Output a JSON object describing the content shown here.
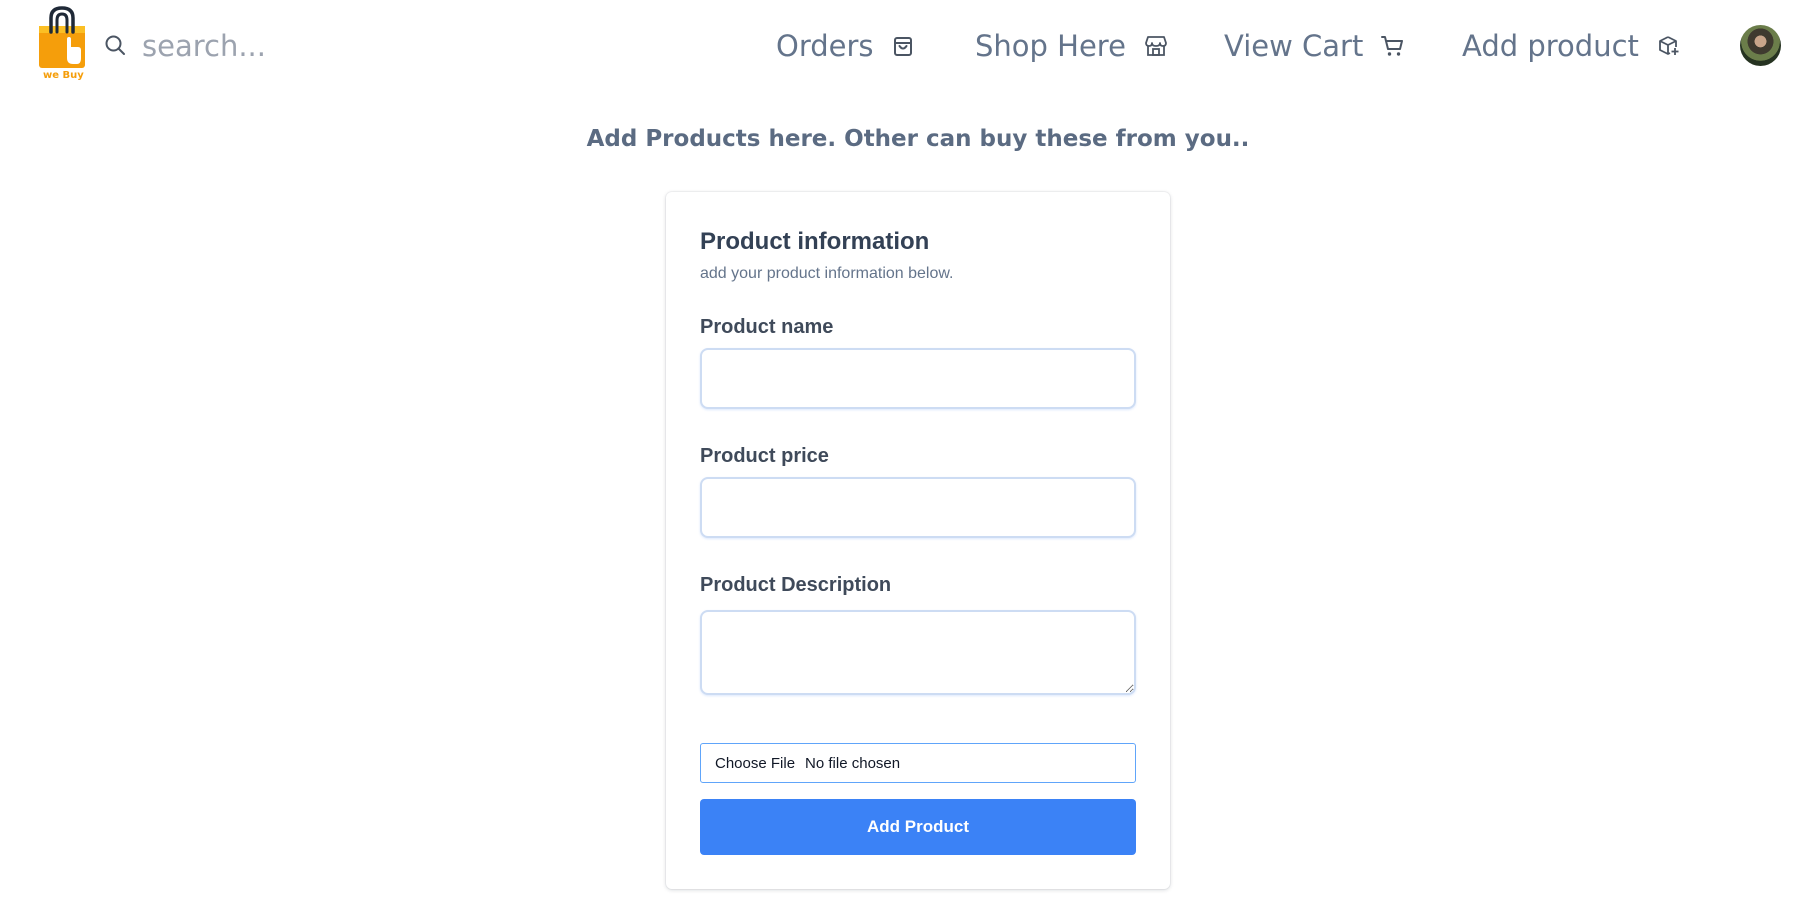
{
  "brand": {
    "logo_text": "we Buy",
    "accent": "#f59e0b",
    "icon": "shopping-bag-hand-icon"
  },
  "search": {
    "placeholder": "search...",
    "value": "",
    "icon": "search-icon"
  },
  "nav": {
    "orders": {
      "label": "Orders",
      "icon": "bag-icon"
    },
    "shop": {
      "label": "Shop Here",
      "icon": "storefront-icon"
    },
    "cart": {
      "label": "View Cart",
      "icon": "cart-icon"
    },
    "add_product": {
      "label": "Add product",
      "icon": "box-plus-icon"
    }
  },
  "user": {
    "avatar": "user-avatar-photo"
  },
  "page": {
    "heading": "Add Products here. Other can buy these from you.."
  },
  "form": {
    "title": "Product information",
    "subtitle": "add your product information below.",
    "fields": {
      "name": {
        "label": "Product name",
        "value": ""
      },
      "price": {
        "label": "Product price",
        "value": ""
      },
      "description": {
        "label": "Product Description",
        "value": ""
      }
    },
    "file": {
      "button_label": "Choose File",
      "status": "No file chosen"
    },
    "submit_label": "Add Product",
    "primary_color": "#3b82f6"
  }
}
